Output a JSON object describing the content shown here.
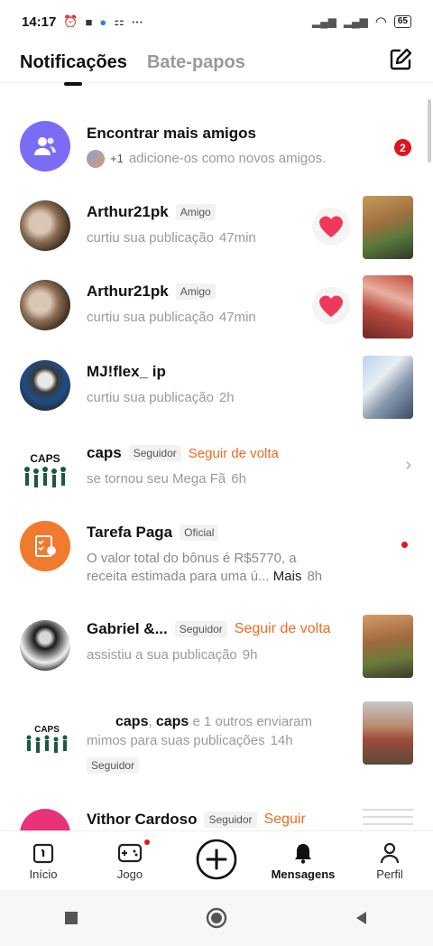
{
  "status_bar": {
    "time": "14:17",
    "battery": "65"
  },
  "tabs": [
    {
      "label": "Notificações"
    },
    {
      "label": "Bate-papos"
    }
  ],
  "notifications": {
    "find_friends": {
      "title": "Encontrar mais amigos",
      "extra_count": "+1",
      "subtitle": "adicione-os como novos amigos.",
      "badge_count": "2"
    },
    "items": [
      {
        "name": "Arthur21pk",
        "tag": "Amigo",
        "action": "curtiu sua publicação",
        "time": "47min"
      },
      {
        "name": "Arthur21pk",
        "tag": "Amigo",
        "action": "curtiu sua publicação",
        "time": "47min"
      },
      {
        "name": "MJ!flex_ ip",
        "action": "curtiu sua publicação",
        "time": "2h"
      },
      {
        "name": "caps",
        "tag": "Seguidor",
        "follow_back": "Seguir de volta",
        "action": "se tornou seu Mega Fã",
        "time": "6h"
      },
      {
        "name": "Tarefa Paga",
        "tag": "Oficial",
        "line1": "O valor total do bônus é R$5770, a",
        "line2": "receita estimada para uma ú...",
        "more": "Mais",
        "time": "8h"
      },
      {
        "name": "Gabriel &...",
        "tag": "Seguidor",
        "follow_back": "Seguir de volta",
        "action": "assistiu a sua publicação",
        "time": "9h"
      },
      {
        "name1": "caps",
        "sep": ",",
        "name2": "caps",
        "line1_rest": "e 1 outros enviaram",
        "line2": "mimos para suas publicações",
        "time": "14h",
        "tag": "Seguidor"
      },
      {
        "name": "Vithor Cardoso",
        "tag": "Seguidor",
        "follow": "Seguir"
      }
    ]
  },
  "bottom_nav": [
    {
      "label": "Início"
    },
    {
      "label": "Jogo"
    },
    {
      "label": ""
    },
    {
      "label": "Mensagens"
    },
    {
      "label": "Perfil"
    }
  ],
  "colors": {
    "accent_orange": "#ef6a1e",
    "find_friends_purple": "#7b6cf6",
    "badge_red": "#e0151c"
  }
}
